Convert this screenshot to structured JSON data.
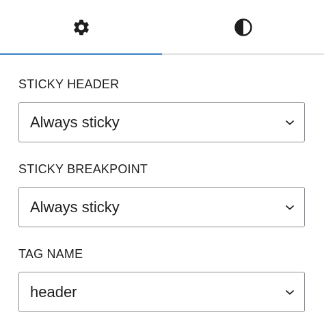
{
  "tabs": [
    {
      "icon": "gear-icon",
      "active": true
    },
    {
      "icon": "contrast-icon",
      "active": false
    }
  ],
  "colors": {
    "accent": "#3582c4",
    "text": "#1e1e1e",
    "border": "#8c8f94",
    "divider": "#e0e0e0"
  },
  "fields": [
    {
      "label": "STICKY HEADER",
      "value": "Always sticky"
    },
    {
      "label": "STICKY BREAKPOINT",
      "value": "Always sticky"
    },
    {
      "label": "TAG NAME",
      "value": "header"
    }
  ]
}
